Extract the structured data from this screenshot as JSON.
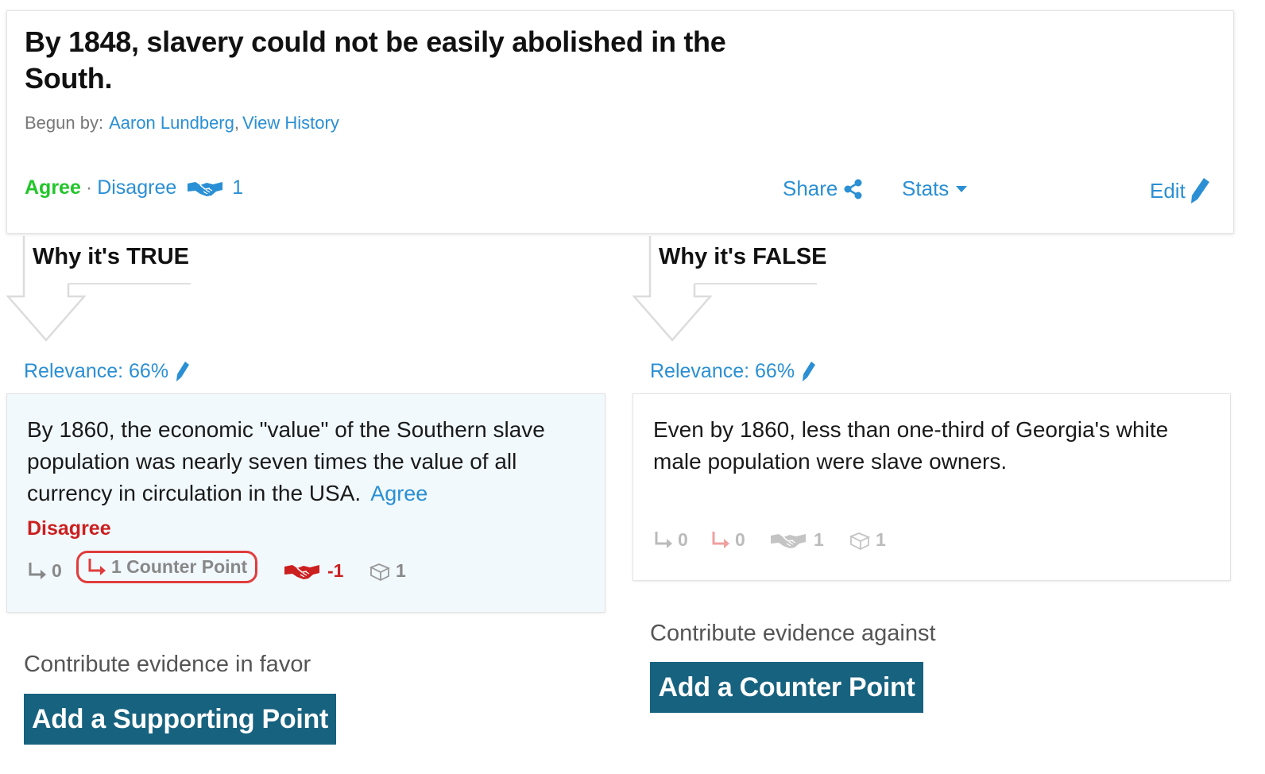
{
  "claim": {
    "title": "By 1848, slavery could not be easily abolished in the South.",
    "begun_label": "Begun by:",
    "author": "Aaron Lundberg",
    "separator": ",",
    "history_link": "View History",
    "agree_label": "Agree",
    "dot": "·",
    "disagree_label": "Disagree",
    "vote_count": "1",
    "share_label": "Share",
    "stats_label": "Stats",
    "edit_label": "Edit"
  },
  "true_column": {
    "heading": "Why it's TRUE",
    "relevance": "Relevance: 66%",
    "point": {
      "text": "By 1860, the economic \"value\" of the Southern slave population was nearly seven times the value of all currency in circulation in the USA.",
      "agree_label": "Agree",
      "disagree_label": "Disagree",
      "supporting_count": "0",
      "counter_label": "1 Counter Point",
      "vote_score": "-1",
      "sources_count": "1"
    },
    "contribute_label": "Contribute evidence in favor",
    "button_label": "Add a Supporting Point"
  },
  "false_column": {
    "heading": "Why it's FALSE",
    "relevance": "Relevance: 66%",
    "point": {
      "text": "Even by 1860, less than one-third of Georgia's white male population were slave owners.",
      "supporting_count": "0",
      "counter_count": "0",
      "vote_score": "1",
      "sources_count": "1"
    },
    "contribute_label": "Contribute evidence against",
    "button_label": "Add a Counter Point"
  },
  "colors": {
    "link_blue": "#2a8fd4",
    "agree_green": "#22c62a",
    "disagree_red": "#cc1f1f",
    "button_teal": "#17627f",
    "highlight_red": "#e03c3c"
  },
  "icons": [
    "handshake-icon",
    "share-icon",
    "caret-down-icon",
    "pencil-icon",
    "arrow-down-outline-icon",
    "reply-arrow-icon",
    "book-icon"
  ]
}
